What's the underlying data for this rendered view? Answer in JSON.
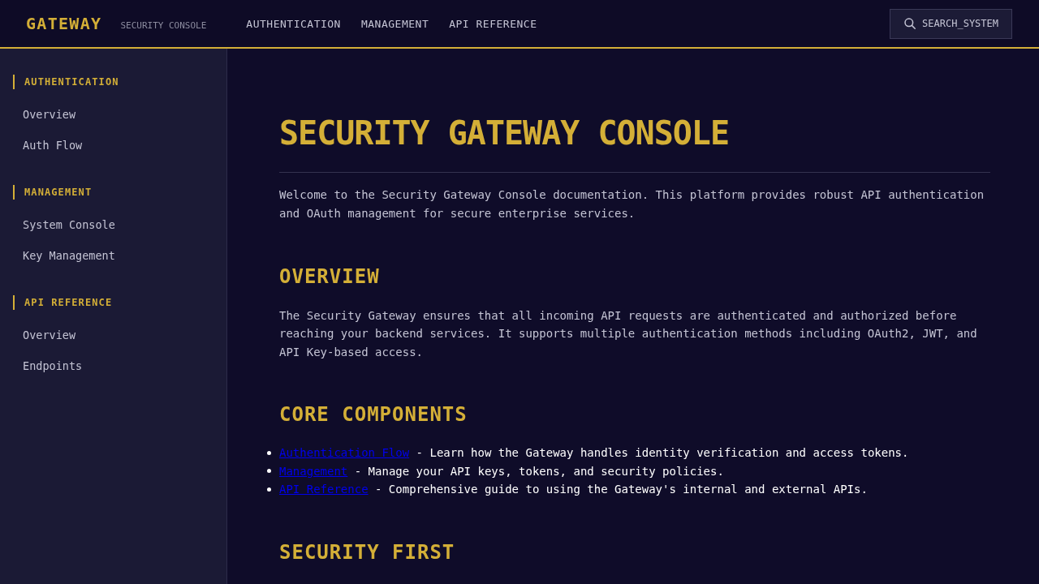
{
  "header": {
    "brand": "GATEWAY",
    "subtitle": "SECURITY CONSOLE",
    "nav": [
      {
        "label": "AUTHENTICATION"
      },
      {
        "label": "MANAGEMENT"
      },
      {
        "label": "API REFERENCE"
      }
    ],
    "search_button": {
      "label": "SEARCH_SYSTEM"
    }
  },
  "sidebar": {
    "sections": [
      {
        "title": "AUTHENTICATION",
        "items": [
          "Overview",
          "Auth Flow"
        ]
      },
      {
        "title": "MANAGEMENT",
        "items": [
          "System Console",
          "Key Management"
        ]
      },
      {
        "title": "API REFERENCE",
        "items": [
          "Overview",
          "Endpoints"
        ]
      }
    ]
  },
  "content": {
    "title": "SECURITY GATEWAY CONSOLE",
    "intro": "Welcome to the Security Gateway Console documentation. This platform provides robust API authentication and OAuth management for secure enterprise services.",
    "sections": [
      {
        "heading": "OVERVIEW",
        "kind": "paragraph",
        "text": "The Security Gateway ensures that all incoming API requests are authenticated and authorized before reaching your backend services. It supports multiple authentication methods including OAuth2, JWT, and API Key-based access."
      },
      {
        "heading": "CORE COMPONENTS",
        "kind": "list",
        "items": [
          {
            "link": "Authentication Flow",
            "text": "- Learn how the Gateway handles identity verification and access tokens."
          },
          {
            "link": "Management",
            "text": "- Manage your API keys, tokens, and security policies."
          },
          {
            "link": "API Reference",
            "text": "- Comprehensive guide to using the Gateway's internal and external APIs."
          }
        ]
      },
      {
        "heading": "SECURITY FIRST",
        "kind": "heading"
      }
    ]
  }
}
